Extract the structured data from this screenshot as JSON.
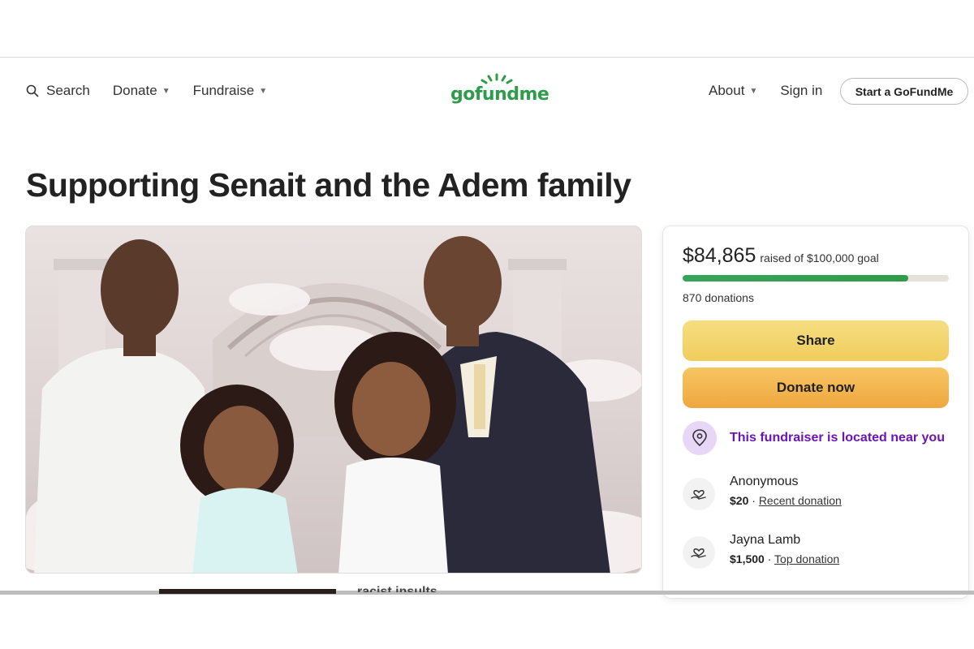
{
  "header": {
    "search_label": "Search",
    "donate_label": "Donate",
    "fundraise_label": "Fundraise",
    "logo_text": "gofundme",
    "about_label": "About",
    "signin_label": "Sign in",
    "start_label": "Start a GoFundMe"
  },
  "page_title": "Supporting Senait and the Adem family",
  "campaign": {
    "raised_amount": "$84,865",
    "raised_goal_text": "raised of $100,000 goal",
    "progress_fraction": 0.849,
    "donation_count": "870 donations",
    "share_label": "Share",
    "donate_now_label": "Donate now",
    "location_text": "This fundraiser is located near you"
  },
  "donors": [
    {
      "name": "Anonymous",
      "amount": "$20",
      "separator": " · ",
      "tag": "Recent donation"
    },
    {
      "name": "Jayna Lamb",
      "amount": "$1,500",
      "separator": " · ",
      "tag": "Top donation"
    }
  ],
  "bottom_cut_text": "racist insults",
  "colors": {
    "brand_green": "#2e9c4a",
    "share_yellow": "#f0cc5c",
    "donate_orange": "#efa73f",
    "location_purple": "#6b15b8"
  }
}
